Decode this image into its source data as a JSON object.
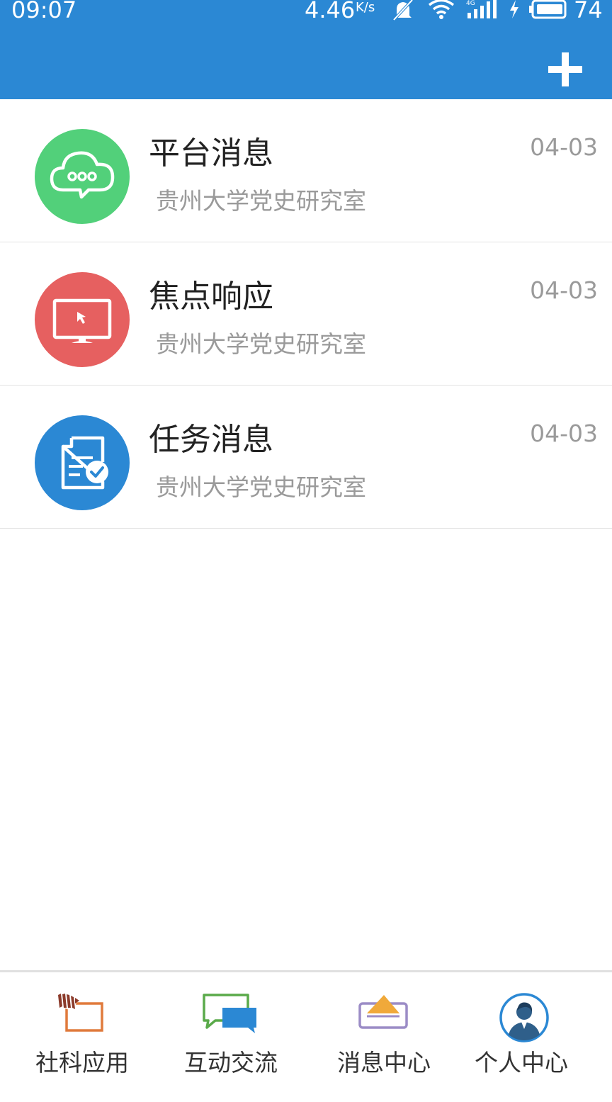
{
  "status_bar": {
    "time": "09:07",
    "net_speed": "4.46",
    "net_speed_unit": "K/s",
    "battery_level": "74"
  },
  "header": {
    "add_icon": "plus-icon"
  },
  "messages": [
    {
      "title": "平台消息",
      "subtitle": "贵州大学党史研究室",
      "date": "04-03",
      "icon": "chat-cloud-icon",
      "color": "#52d07a"
    },
    {
      "title": "焦点响应",
      "subtitle": "贵州大学党史研究室",
      "date": "04-03",
      "icon": "monitor-cursor-icon",
      "color": "#e66060"
    },
    {
      "title": "任务消息",
      "subtitle": "贵州大学党史研究室",
      "date": "04-03",
      "icon": "document-check-icon",
      "color": "#2b88d4"
    }
  ],
  "bottom_nav": [
    {
      "label": "社科应用",
      "icon": "social-science-app-icon"
    },
    {
      "label": "互动交流",
      "icon": "chat-bubbles-icon"
    },
    {
      "label": "消息中心",
      "icon": "message-tray-icon"
    },
    {
      "label": "个人中心",
      "icon": "user-avatar-icon"
    }
  ],
  "colors": {
    "primary": "#2b88d4",
    "muted_text": "#9a9a9a"
  }
}
